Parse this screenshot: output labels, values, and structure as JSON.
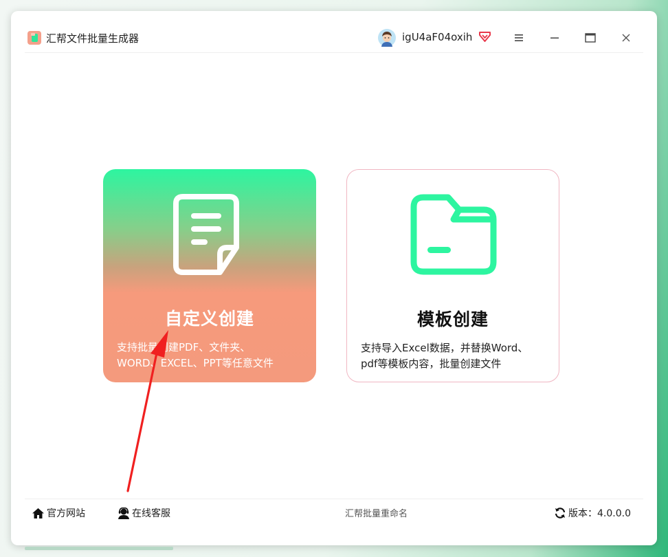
{
  "app": {
    "title": "汇帮文件批量生成器",
    "username": "igU4aF04oxih"
  },
  "cards": {
    "custom": {
      "title": "自定义创建",
      "desc_line1": "支持批量创建PDF、文件夹、",
      "desc_line2": "WORD、EXCEL、PPT等任意文件"
    },
    "template": {
      "title": "模板创建",
      "desc_line1": "支持导入Excel数据，并替换Word、",
      "desc_line2": "pdf等模板内容，批量创建文件"
    }
  },
  "footer": {
    "website_label": "官方网站",
    "support_label": "在线客服",
    "center_text": "汇帮批量重命名",
    "version_label": "版本：4.0.0.0"
  },
  "icons": {
    "app": "app-logo-icon",
    "avatar": "user-avatar",
    "vip": "vip-diamond-icon",
    "menu": "menu-icon",
    "minimize": "minimize-icon",
    "maximize": "maximize-icon",
    "close": "close-icon",
    "home": "home-icon",
    "support": "support-icon",
    "refresh": "refresh-icon",
    "document": "document-icon",
    "folder": "folder-icon"
  },
  "colors": {
    "accent_green": "#2df5a0",
    "accent_salmon": "#f49a7d",
    "vip_red": "#e8384b",
    "template_border": "#f0b6c2",
    "annotation_arrow": "#f02020"
  }
}
